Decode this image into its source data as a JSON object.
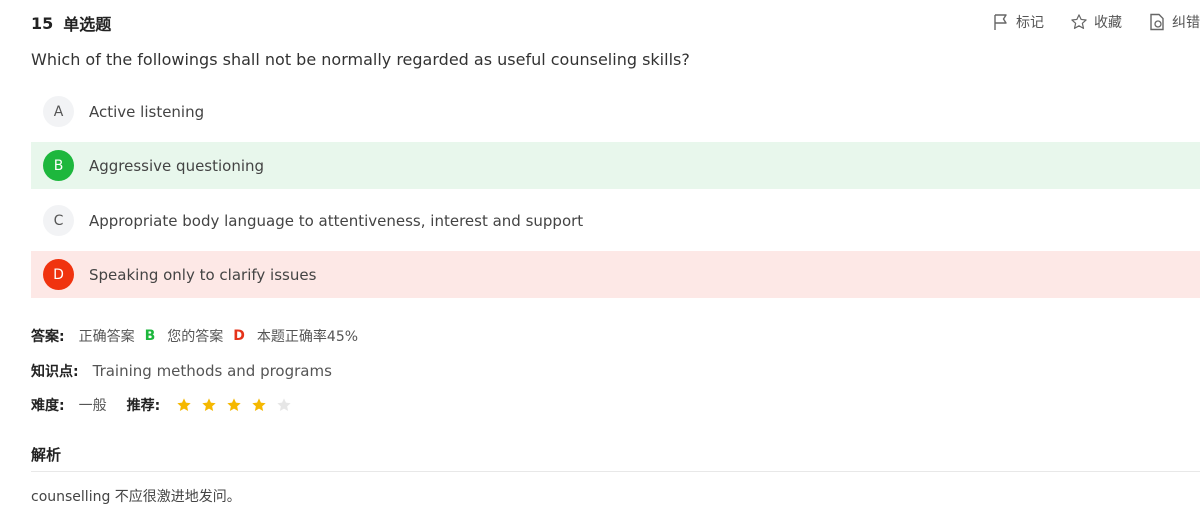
{
  "question": {
    "number": "15",
    "type": "单选题",
    "stem": "Which of the followings shall not be normally regarded as useful counseling skills?"
  },
  "actions": [
    {
      "label": "标记",
      "icon": "flag-icon"
    },
    {
      "label": "收藏",
      "icon": "star-outline-icon"
    },
    {
      "label": "纠错",
      "icon": "report-icon"
    }
  ],
  "options": [
    {
      "letter": "A",
      "text": "Active listening",
      "state": "normal"
    },
    {
      "letter": "B",
      "text": "Aggressive questioning",
      "state": "correct"
    },
    {
      "letter": "C",
      "text": "Appropriate body language to attentiveness, interest and support",
      "state": "normal"
    },
    {
      "letter": "D",
      "text": "Speaking only to clarify issues",
      "state": "wrong"
    }
  ],
  "answer": {
    "label": "答案:",
    "correct_label": "正确答案",
    "correct_value": "B",
    "yours_label": "您的答案",
    "yours_value": "D",
    "rate_text": "本题正确率45%"
  },
  "knowledge": {
    "label": "知识点:",
    "value": "Training methods and programs"
  },
  "difficulty": {
    "label": "难度:",
    "value": "一般",
    "recommend_label": "推荐:",
    "stars_filled": 4,
    "stars_total": 5
  },
  "analysis": {
    "title": "解析",
    "text": "counselling 不应很激进地发问。"
  },
  "colors": {
    "correct": "#1db73d",
    "wrong": "#f0330f",
    "correct_bg": "#e8f7ec",
    "wrong_bg": "#fde8e6",
    "star": "#f5b800",
    "star_empty": "#e6e6e6"
  }
}
